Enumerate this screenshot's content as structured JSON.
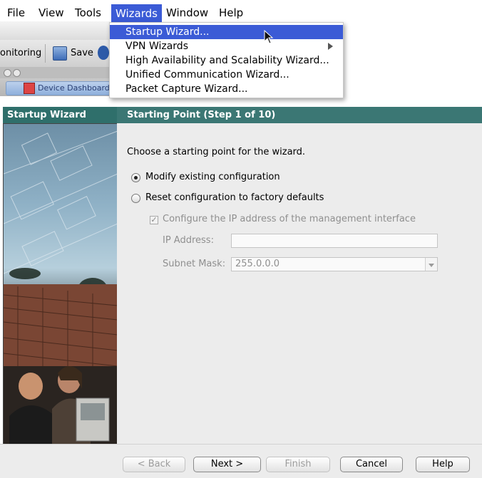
{
  "menubar": {
    "items": [
      "File",
      "View",
      "Tools",
      "Wizards",
      "Window",
      "Help"
    ],
    "active": "Wizards"
  },
  "background_app": {
    "monitoring_label": "onitoring",
    "save_label": "Save",
    "tab_label": "Device Dashboard"
  },
  "wizards_menu": {
    "items": [
      {
        "label": "Startup Wizard...",
        "selected": true,
        "submenu": false
      },
      {
        "label": "VPN Wizards",
        "selected": false,
        "submenu": true
      },
      {
        "label": "High Availability and Scalability Wizard...",
        "selected": false,
        "submenu": false
      },
      {
        "label": "Unified Communication Wizard...",
        "selected": false,
        "submenu": false
      },
      {
        "label": "Packet Capture Wizard...",
        "selected": false,
        "submenu": false
      }
    ]
  },
  "wizard": {
    "left_title": "Startup Wizard",
    "step_title": "Starting Point  (Step 1 of 10)",
    "instruction": "Choose a starting point for the wizard.",
    "options": [
      {
        "label": "Modify existing configuration",
        "checked": true
      },
      {
        "label": "Reset configuration to factory defaults",
        "checked": false
      }
    ],
    "checkbox_label": "Configure the IP address of the management interface",
    "ip_label": "IP Address:",
    "ip_value": "",
    "mask_label": "Subnet Mask:",
    "mask_value": "255.0.0.0"
  },
  "buttons": {
    "back": "< Back",
    "next": "Next >",
    "finish": "Finish",
    "cancel": "Cancel",
    "help": "Help"
  },
  "colors": {
    "menu_highlight": "#3b5bd6",
    "wizard_header": "#3b7774",
    "panel_background": "#ececec"
  }
}
